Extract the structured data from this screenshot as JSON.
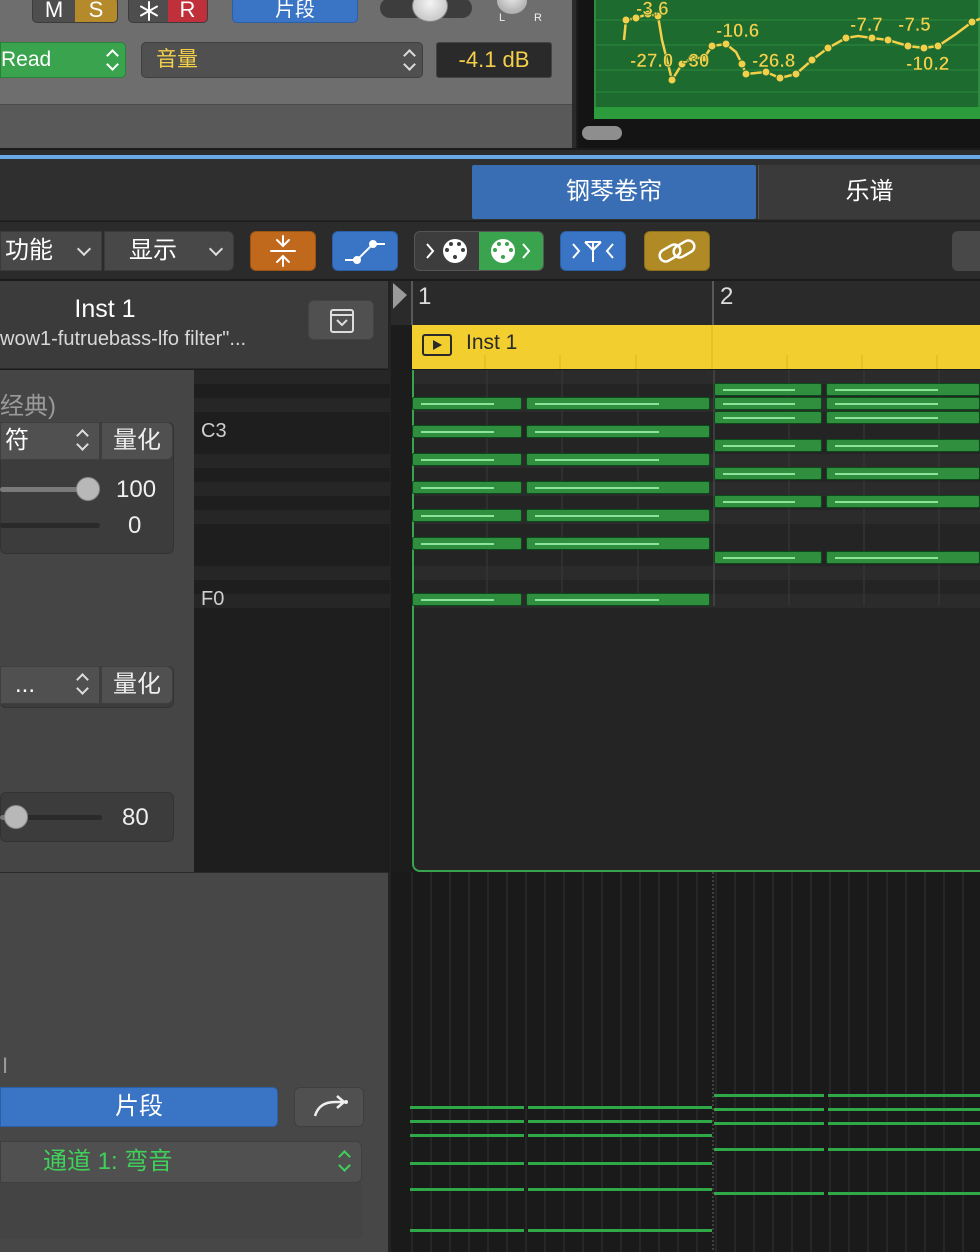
{
  "track_header": {
    "mute_label": "M",
    "solo_label": "S",
    "freeze_icon": "snowflake-icon",
    "record_label": "R",
    "region_button_label": "片段",
    "pan_left_label": "L",
    "pan_right_label": "R",
    "automation_mode": "Read",
    "automation_param": "音量",
    "volume_readout": "-4.1 dB"
  },
  "automation_values": [
    "-3.6",
    "-10.6",
    "-7.7",
    "-7.5",
    "-27.0",
    "-30",
    "-26.8",
    "-10.2"
  ],
  "editor_tabs": [
    {
      "label": "钢琴卷帘",
      "active": true
    },
    {
      "label": "乐谱",
      "active": false
    }
  ],
  "toolbar": {
    "functions_label": "功能",
    "view_label": "显示",
    "tools": [
      "collapse-icon",
      "automation-icon",
      "midi-in-icon",
      "midi-out-icon",
      "quantize-icon",
      "link-icon"
    ]
  },
  "inspector": {
    "track_name": "Inst 1",
    "patch_name": "wow1-futruebass-lfo filter\"...",
    "time_quantize_heading": "经典)",
    "note_select": "符",
    "quantize_label": "量化",
    "strength_value": "100",
    "swing_value": "0",
    "scale_select": "...",
    "scale_quantize_label": "量化",
    "velocity_value": "80",
    "region_button": "片段",
    "channel_select": "通道 1: 弯音",
    "fragment_label": "I"
  },
  "keys": {
    "c3_label": "C3",
    "f0_label": "F0"
  },
  "ruler": {
    "bar1": "1",
    "bar2": "2"
  },
  "region": {
    "name": "Inst 1",
    "color": "#f2cf2e"
  },
  "colors": {
    "accent_blue": "#3a74c4",
    "note_green": "#2f8f3f",
    "automation_yellow": "#f4d04a"
  }
}
